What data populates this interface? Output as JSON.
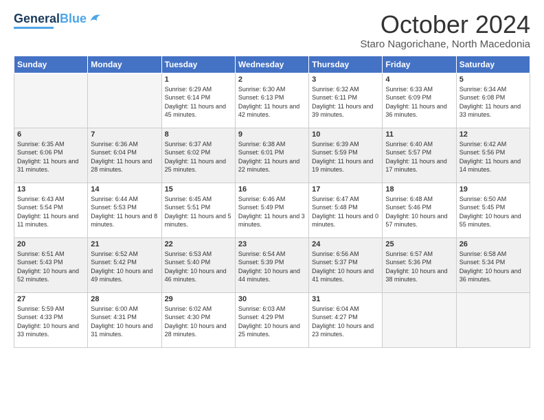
{
  "header": {
    "logo_general": "General",
    "logo_blue": "Blue",
    "main_title": "October 2024",
    "subtitle": "Staro Nagorichane, North Macedonia"
  },
  "calendar": {
    "days_of_week": [
      "Sunday",
      "Monday",
      "Tuesday",
      "Wednesday",
      "Thursday",
      "Friday",
      "Saturday"
    ],
    "weeks": [
      [
        {
          "day": "",
          "info": ""
        },
        {
          "day": "",
          "info": ""
        },
        {
          "day": "1",
          "info": "Sunrise: 6:29 AM\nSunset: 6:14 PM\nDaylight: 11 hours and 45 minutes."
        },
        {
          "day": "2",
          "info": "Sunrise: 6:30 AM\nSunset: 6:13 PM\nDaylight: 11 hours and 42 minutes."
        },
        {
          "day": "3",
          "info": "Sunrise: 6:32 AM\nSunset: 6:11 PM\nDaylight: 11 hours and 39 minutes."
        },
        {
          "day": "4",
          "info": "Sunrise: 6:33 AM\nSunset: 6:09 PM\nDaylight: 11 hours and 36 minutes."
        },
        {
          "day": "5",
          "info": "Sunrise: 6:34 AM\nSunset: 6:08 PM\nDaylight: 11 hours and 33 minutes."
        }
      ],
      [
        {
          "day": "6",
          "info": "Sunrise: 6:35 AM\nSunset: 6:06 PM\nDaylight: 11 hours and 31 minutes."
        },
        {
          "day": "7",
          "info": "Sunrise: 6:36 AM\nSunset: 6:04 PM\nDaylight: 11 hours and 28 minutes."
        },
        {
          "day": "8",
          "info": "Sunrise: 6:37 AM\nSunset: 6:02 PM\nDaylight: 11 hours and 25 minutes."
        },
        {
          "day": "9",
          "info": "Sunrise: 6:38 AM\nSunset: 6:01 PM\nDaylight: 11 hours and 22 minutes."
        },
        {
          "day": "10",
          "info": "Sunrise: 6:39 AM\nSunset: 5:59 PM\nDaylight: 11 hours and 19 minutes."
        },
        {
          "day": "11",
          "info": "Sunrise: 6:40 AM\nSunset: 5:57 PM\nDaylight: 11 hours and 17 minutes."
        },
        {
          "day": "12",
          "info": "Sunrise: 6:42 AM\nSunset: 5:56 PM\nDaylight: 11 hours and 14 minutes."
        }
      ],
      [
        {
          "day": "13",
          "info": "Sunrise: 6:43 AM\nSunset: 5:54 PM\nDaylight: 11 hours and 11 minutes."
        },
        {
          "day": "14",
          "info": "Sunrise: 6:44 AM\nSunset: 5:53 PM\nDaylight: 11 hours and 8 minutes."
        },
        {
          "day": "15",
          "info": "Sunrise: 6:45 AM\nSunset: 5:51 PM\nDaylight: 11 hours and 5 minutes."
        },
        {
          "day": "16",
          "info": "Sunrise: 6:46 AM\nSunset: 5:49 PM\nDaylight: 11 hours and 3 minutes."
        },
        {
          "day": "17",
          "info": "Sunrise: 6:47 AM\nSunset: 5:48 PM\nDaylight: 11 hours and 0 minutes."
        },
        {
          "day": "18",
          "info": "Sunrise: 6:48 AM\nSunset: 5:46 PM\nDaylight: 10 hours and 57 minutes."
        },
        {
          "day": "19",
          "info": "Sunrise: 6:50 AM\nSunset: 5:45 PM\nDaylight: 10 hours and 55 minutes."
        }
      ],
      [
        {
          "day": "20",
          "info": "Sunrise: 6:51 AM\nSunset: 5:43 PM\nDaylight: 10 hours and 52 minutes."
        },
        {
          "day": "21",
          "info": "Sunrise: 6:52 AM\nSunset: 5:42 PM\nDaylight: 10 hours and 49 minutes."
        },
        {
          "day": "22",
          "info": "Sunrise: 6:53 AM\nSunset: 5:40 PM\nDaylight: 10 hours and 46 minutes."
        },
        {
          "day": "23",
          "info": "Sunrise: 6:54 AM\nSunset: 5:39 PM\nDaylight: 10 hours and 44 minutes."
        },
        {
          "day": "24",
          "info": "Sunrise: 6:56 AM\nSunset: 5:37 PM\nDaylight: 10 hours and 41 minutes."
        },
        {
          "day": "25",
          "info": "Sunrise: 6:57 AM\nSunset: 5:36 PM\nDaylight: 10 hours and 38 minutes."
        },
        {
          "day": "26",
          "info": "Sunrise: 6:58 AM\nSunset: 5:34 PM\nDaylight: 10 hours and 36 minutes."
        }
      ],
      [
        {
          "day": "27",
          "info": "Sunrise: 5:59 AM\nSunset: 4:33 PM\nDaylight: 10 hours and 33 minutes."
        },
        {
          "day": "28",
          "info": "Sunrise: 6:00 AM\nSunset: 4:31 PM\nDaylight: 10 hours and 31 minutes."
        },
        {
          "day": "29",
          "info": "Sunrise: 6:02 AM\nSunset: 4:30 PM\nDaylight: 10 hours and 28 minutes."
        },
        {
          "day": "30",
          "info": "Sunrise: 6:03 AM\nSunset: 4:29 PM\nDaylight: 10 hours and 25 minutes."
        },
        {
          "day": "31",
          "info": "Sunrise: 6:04 AM\nSunset: 4:27 PM\nDaylight: 10 hours and 23 minutes."
        },
        {
          "day": "",
          "info": ""
        },
        {
          "day": "",
          "info": ""
        }
      ]
    ]
  }
}
